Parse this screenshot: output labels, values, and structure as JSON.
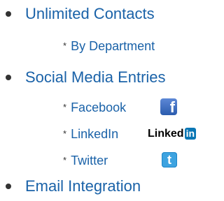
{
  "features": {
    "unlimited_contacts": {
      "label": "Unlimited Contacts",
      "sub_items": [
        {
          "marker": "*",
          "label": "By Department"
        }
      ]
    },
    "social_media": {
      "label": "Social Media Entries",
      "sub_items": [
        {
          "marker": "*",
          "label": "Facebook",
          "icon": "facebook-icon",
          "icon_glyph": "f"
        },
        {
          "marker": "*",
          "label": "LinkedIn",
          "icon": "linkedin-logo",
          "logo_word": "Linked",
          "logo_badge": "in"
        },
        {
          "marker": "*",
          "label": "Twitter",
          "icon": "twitter-icon",
          "icon_glyph": "t"
        }
      ]
    },
    "email_integration": {
      "label": "Email Integration"
    }
  },
  "colors": {
    "text": "#1a62a8",
    "bullet": "#333333",
    "facebook": "#3b5998",
    "linkedin": "#0a77b5",
    "twitter": "#3da3e0"
  }
}
